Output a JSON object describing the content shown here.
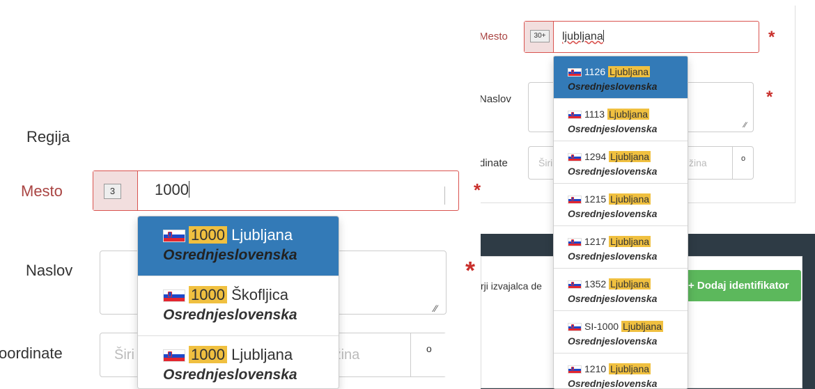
{
  "left": {
    "regija_label": "Regija",
    "mesto_label": "Mesto",
    "mesto_badge": "3",
    "mesto_value": "1000",
    "naslov_label": "Naslov",
    "koordinate_label": "oordinate",
    "coord_lat_placeholder": "Širi",
    "coord_lng_placeholder": "olžina",
    "coord_unit": "o",
    "required_star": "*",
    "results": [
      {
        "code": "1000",
        "city": "Ljubljana",
        "region": "Osrednjeslovenska",
        "active": true
      },
      {
        "code": "1000",
        "city": "Škofljica",
        "region": "Osrednjeslovenska",
        "active": false
      },
      {
        "code": "1000",
        "city": "Ljubljana",
        "region": "Osrednjeslovenska",
        "active": false
      }
    ]
  },
  "right": {
    "mesto_label": "Mesto",
    "mesto_badge": "30+",
    "mesto_value": "ljubljana",
    "naslov_label": "Naslov",
    "koordinate_label": "dinate",
    "coord_lat_placeholder": "Širi",
    "coord_lng_placeholder": "žina",
    "coord_unit": "o",
    "required_star": "*",
    "footer_text_cut": "rji izvajalca de",
    "add_identifier_label": "+ Dodaj identifikator",
    "results": [
      {
        "code": "1126",
        "city": "Ljubljana",
        "region": "Osrednjeslovenska",
        "active": true
      },
      {
        "code": "1113",
        "city": "Ljubljana",
        "region": "Osrednjeslovenska",
        "active": false
      },
      {
        "code": "1294",
        "city": "Ljubljana",
        "region": "Osrednjeslovenska",
        "active": false
      },
      {
        "code": "1215",
        "city": "Ljubljana",
        "region": "Osrednjeslovenska",
        "active": false
      },
      {
        "code": "1217",
        "city": "Ljubljana",
        "region": "Osrednjeslovenska",
        "active": false
      },
      {
        "code": "1352",
        "city": "Ljubljana",
        "region": "Osrednjeslovenska",
        "active": false
      },
      {
        "code": "SI-1000",
        "city": "Ljubljana",
        "region": "Osrednjeslovenska",
        "active": false
      },
      {
        "code": "1210",
        "city": "Ljubljana",
        "region": "Osrednjeslovenska",
        "active": false
      }
    ]
  },
  "colors": {
    "error_red": "#a94442",
    "active_blue": "#337ab7",
    "highlight_yellow": "#f0c040",
    "success_green": "#5cb85c",
    "dark_panel": "#2e3b45"
  },
  "icons": [
    "slovenia-flag-icon",
    "resize-handle-icon",
    "text-cursor-icon"
  ]
}
